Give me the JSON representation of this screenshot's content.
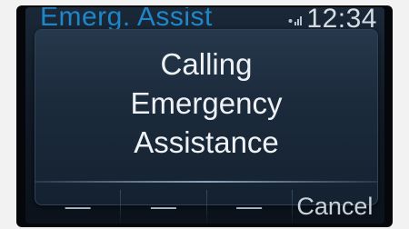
{
  "status_bar": {
    "title": "Emerg. Assist",
    "time": "12:34",
    "signal_icon": "signal-icon"
  },
  "dialog": {
    "lines": [
      "Calling",
      "Emergency",
      "Assistance"
    ]
  },
  "softkeys": [
    "—",
    "—",
    "—",
    "Cancel"
  ],
  "colors": {
    "title_blue": "#1f86c9",
    "screen_bg": "#0f1824",
    "text": "#eef2f6"
  }
}
